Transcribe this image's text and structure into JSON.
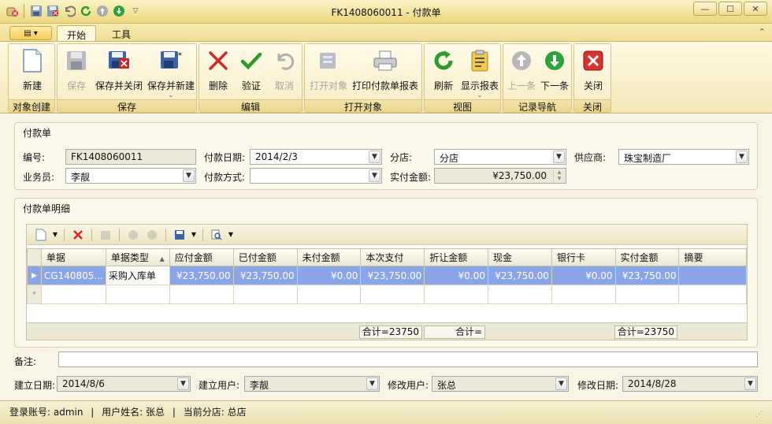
{
  "window": {
    "title": "FK1408060011 - 付款单"
  },
  "tabs": {
    "home": "开始",
    "tools": "工具"
  },
  "ribbon": {
    "groups": {
      "create": "对象创建",
      "save": "保存",
      "edit": "编辑",
      "open": "打开对象",
      "view": "视图",
      "nav": "记录导航",
      "close": "关闭"
    },
    "buttons": {
      "new": "新建",
      "save": "保存",
      "save_close": "保存并关闭",
      "save_new": "保存并新建",
      "delete": "删除",
      "validate": "验证",
      "cancel": "取消",
      "open_object": "打开对象",
      "print_report": "打印付款单报表",
      "refresh": "刷新",
      "show_report": "显示报表",
      "prev": "上一条",
      "next": "下一条",
      "close": "关闭"
    }
  },
  "header_section": {
    "legend": "付款单",
    "number_label": "编号:",
    "number_value": "FK1408060011",
    "date_label": "付款日期:",
    "date_value": "2014/2/3",
    "branch_label": "分店:",
    "branch_value": "分店",
    "supplier_label": "供应商:",
    "supplier_value": "珠宝制造厂",
    "staff_label": "业务员:",
    "staff_value": "李靓",
    "method_label": "付款方式:",
    "method_value": "",
    "amount_label": "实付金额:",
    "amount_value": "¥23,750.00"
  },
  "detail_section": {
    "legend": "付款单明细",
    "columns": [
      "单据",
      "单据类型",
      "应付金额",
      "已付金额",
      "未付金额",
      "本次支付",
      "折让金额",
      "现金",
      "银行卡",
      "实付金额",
      "摘要"
    ],
    "rows": [
      [
        "CG140805...",
        "采购入库单",
        "¥23,750.00",
        "¥23,750.00",
        "¥0.00",
        "¥23,750.00",
        "¥0.00",
        "¥23,750.00",
        "¥0.00",
        "¥23,750.00",
        ""
      ]
    ],
    "new_row_marker": "*",
    "summary": {
      "s1": "合计=23750",
      "s2": "合计=",
      "s3": "合计=23750"
    }
  },
  "footer_fields": {
    "remark_label": "备注:",
    "remark_value": "",
    "created_date_label": "建立日期:",
    "created_date_value": "2014/8/6",
    "created_user_label": "建立用户:",
    "created_user_value": "李靓",
    "modified_user_label": "修改用户:",
    "modified_user_value": "张总",
    "modified_date_label": "修改日期:",
    "modified_date_value": "2014/8/28"
  },
  "status": {
    "account": "登录账号: admin",
    "sep1": "|",
    "user": "用户姓名: 张总",
    "sep2": "|",
    "branch": "当前分店: 总店"
  }
}
